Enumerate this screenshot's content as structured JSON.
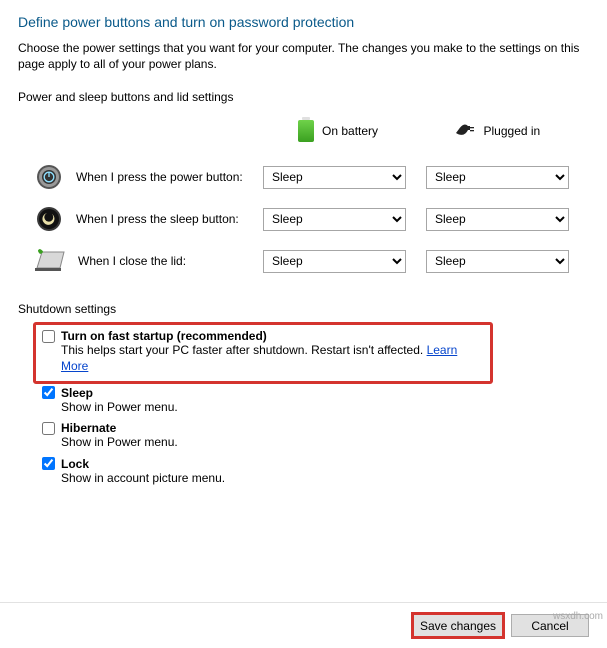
{
  "header": {
    "title": "Define power buttons and turn on password protection",
    "subtitle": "Choose the power settings that you want for your computer. The changes you make to the settings on this page apply to all of your power plans."
  },
  "section1": {
    "label": "Power and sleep buttons and lid settings",
    "col_battery": "On battery",
    "col_plugged": "Plugged in",
    "rows": [
      {
        "label": "When I press the power button:",
        "battery": "Sleep",
        "plugged": "Sleep"
      },
      {
        "label": "When I press the sleep button:",
        "battery": "Sleep",
        "plugged": "Sleep"
      },
      {
        "label": "When I close the lid:",
        "battery": "Sleep",
        "plugged": "Sleep"
      }
    ]
  },
  "section2": {
    "label": "Shutdown settings",
    "options": [
      {
        "title": "Turn on fast startup (recommended)",
        "desc": "This helps start your PC faster after shutdown. Restart isn't affected. ",
        "checked": false,
        "link": "Learn More"
      },
      {
        "title": "Sleep",
        "desc": "Show in Power menu.",
        "checked": true
      },
      {
        "title": "Hibernate",
        "desc": "Show in Power menu.",
        "checked": false
      },
      {
        "title": "Lock",
        "desc": "Show in account picture menu.",
        "checked": true
      }
    ]
  },
  "buttons": {
    "save": "Save changes",
    "cancel": "Cancel"
  },
  "watermark": "wsxdh.com"
}
